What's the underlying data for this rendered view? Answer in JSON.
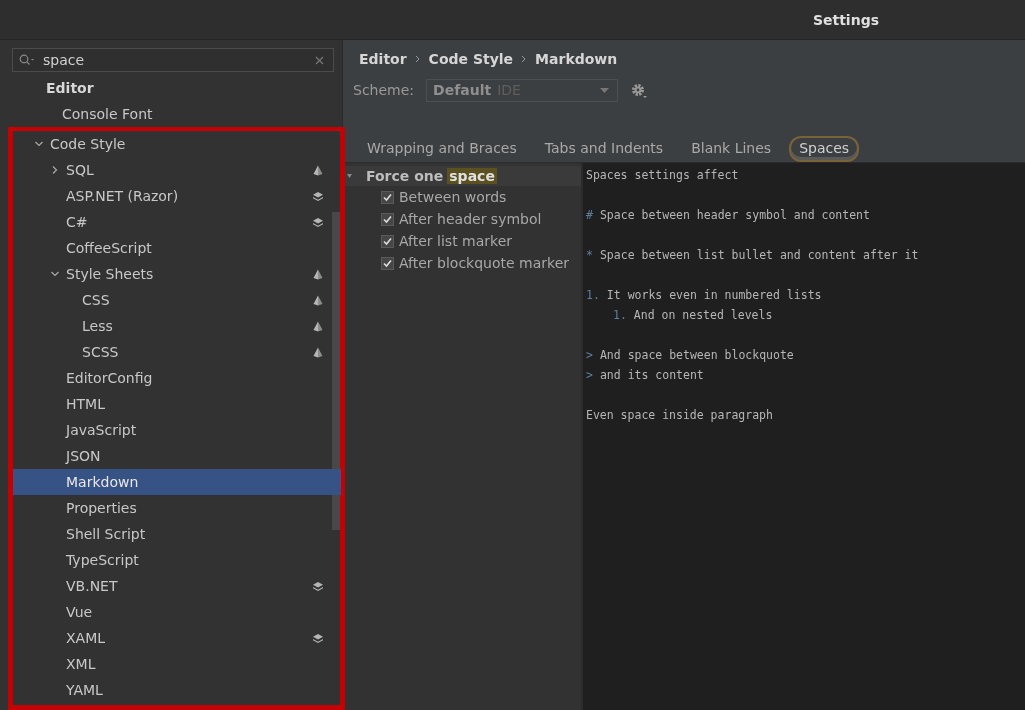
{
  "window": {
    "title": "Settings"
  },
  "search": {
    "value": "space"
  },
  "tree": [
    {
      "label": "Editor",
      "bold": true,
      "children": [
        {
          "label": "Console Font"
        },
        {
          "label": "Code Style",
          "expanded": true,
          "children": [
            {
              "label": "SQL",
              "expanded": false,
              "kind": "pyramid"
            },
            {
              "label": "ASP.NET (Razor)",
              "kind": "layers"
            },
            {
              "label": "C#",
              "kind": "layers"
            },
            {
              "label": "CoffeeScript"
            },
            {
              "label": "Style Sheets",
              "expanded": true,
              "kind": "pyramid",
              "children": [
                {
                  "label": "CSS",
                  "kind": "pyramid"
                },
                {
                  "label": "Less",
                  "kind": "pyramid"
                },
                {
                  "label": "SCSS",
                  "kind": "pyramid"
                }
              ]
            },
            {
              "label": "EditorConfig"
            },
            {
              "label": "HTML"
            },
            {
              "label": "JavaScript"
            },
            {
              "label": "JSON"
            },
            {
              "label": "Markdown",
              "selected": true
            },
            {
              "label": "Properties"
            },
            {
              "label": "Shell Script"
            },
            {
              "label": "TypeScript"
            },
            {
              "label": "VB.NET",
              "kind": "layers"
            },
            {
              "label": "Vue"
            },
            {
              "label": "XAML",
              "kind": "layers"
            },
            {
              "label": "XML"
            },
            {
              "label": "YAML"
            }
          ]
        }
      ]
    }
  ],
  "breadcrumb": [
    "Editor",
    "Code Style",
    "Markdown"
  ],
  "scheme": {
    "label": "Scheme:",
    "value": "Default",
    "origin": "IDE"
  },
  "tabs": [
    {
      "label": "Wrapping and Braces",
      "selected": false
    },
    {
      "label": "Tabs and Indents",
      "selected": false
    },
    {
      "label": "Blank Lines",
      "selected": false
    },
    {
      "label": "Spaces",
      "selected": true
    }
  ],
  "options": {
    "group": "Force one",
    "match": "space",
    "items": [
      {
        "label": "Between words",
        "checked": true
      },
      {
        "label": "After header symbol",
        "checked": true
      },
      {
        "label": "After list marker",
        "checked": true
      },
      {
        "label": "After blockquote marker",
        "checked": true
      }
    ]
  },
  "preview": [
    {
      "kind": "text",
      "text": "Spaces settings affect"
    },
    {
      "kind": "blank"
    },
    {
      "kind": "marked",
      "marker": "#",
      "text": "Space between header symbol and content"
    },
    {
      "kind": "blank"
    },
    {
      "kind": "marked",
      "marker": "*",
      "text": "Space between list bullet and content after it"
    },
    {
      "kind": "blank"
    },
    {
      "kind": "marked",
      "marker": "1.",
      "text": "It works even in numbered lists"
    },
    {
      "kind": "nested",
      "marker": "1.",
      "text": "And on nested levels"
    },
    {
      "kind": "blank"
    },
    {
      "kind": "marked",
      "marker": ">",
      "text": "And space between blockquote"
    },
    {
      "kind": "marked",
      "marker": ">",
      "text": "and its content"
    },
    {
      "kind": "blank"
    },
    {
      "kind": "text",
      "text": "Even space inside paragraph"
    }
  ],
  "highlight_frame": true
}
